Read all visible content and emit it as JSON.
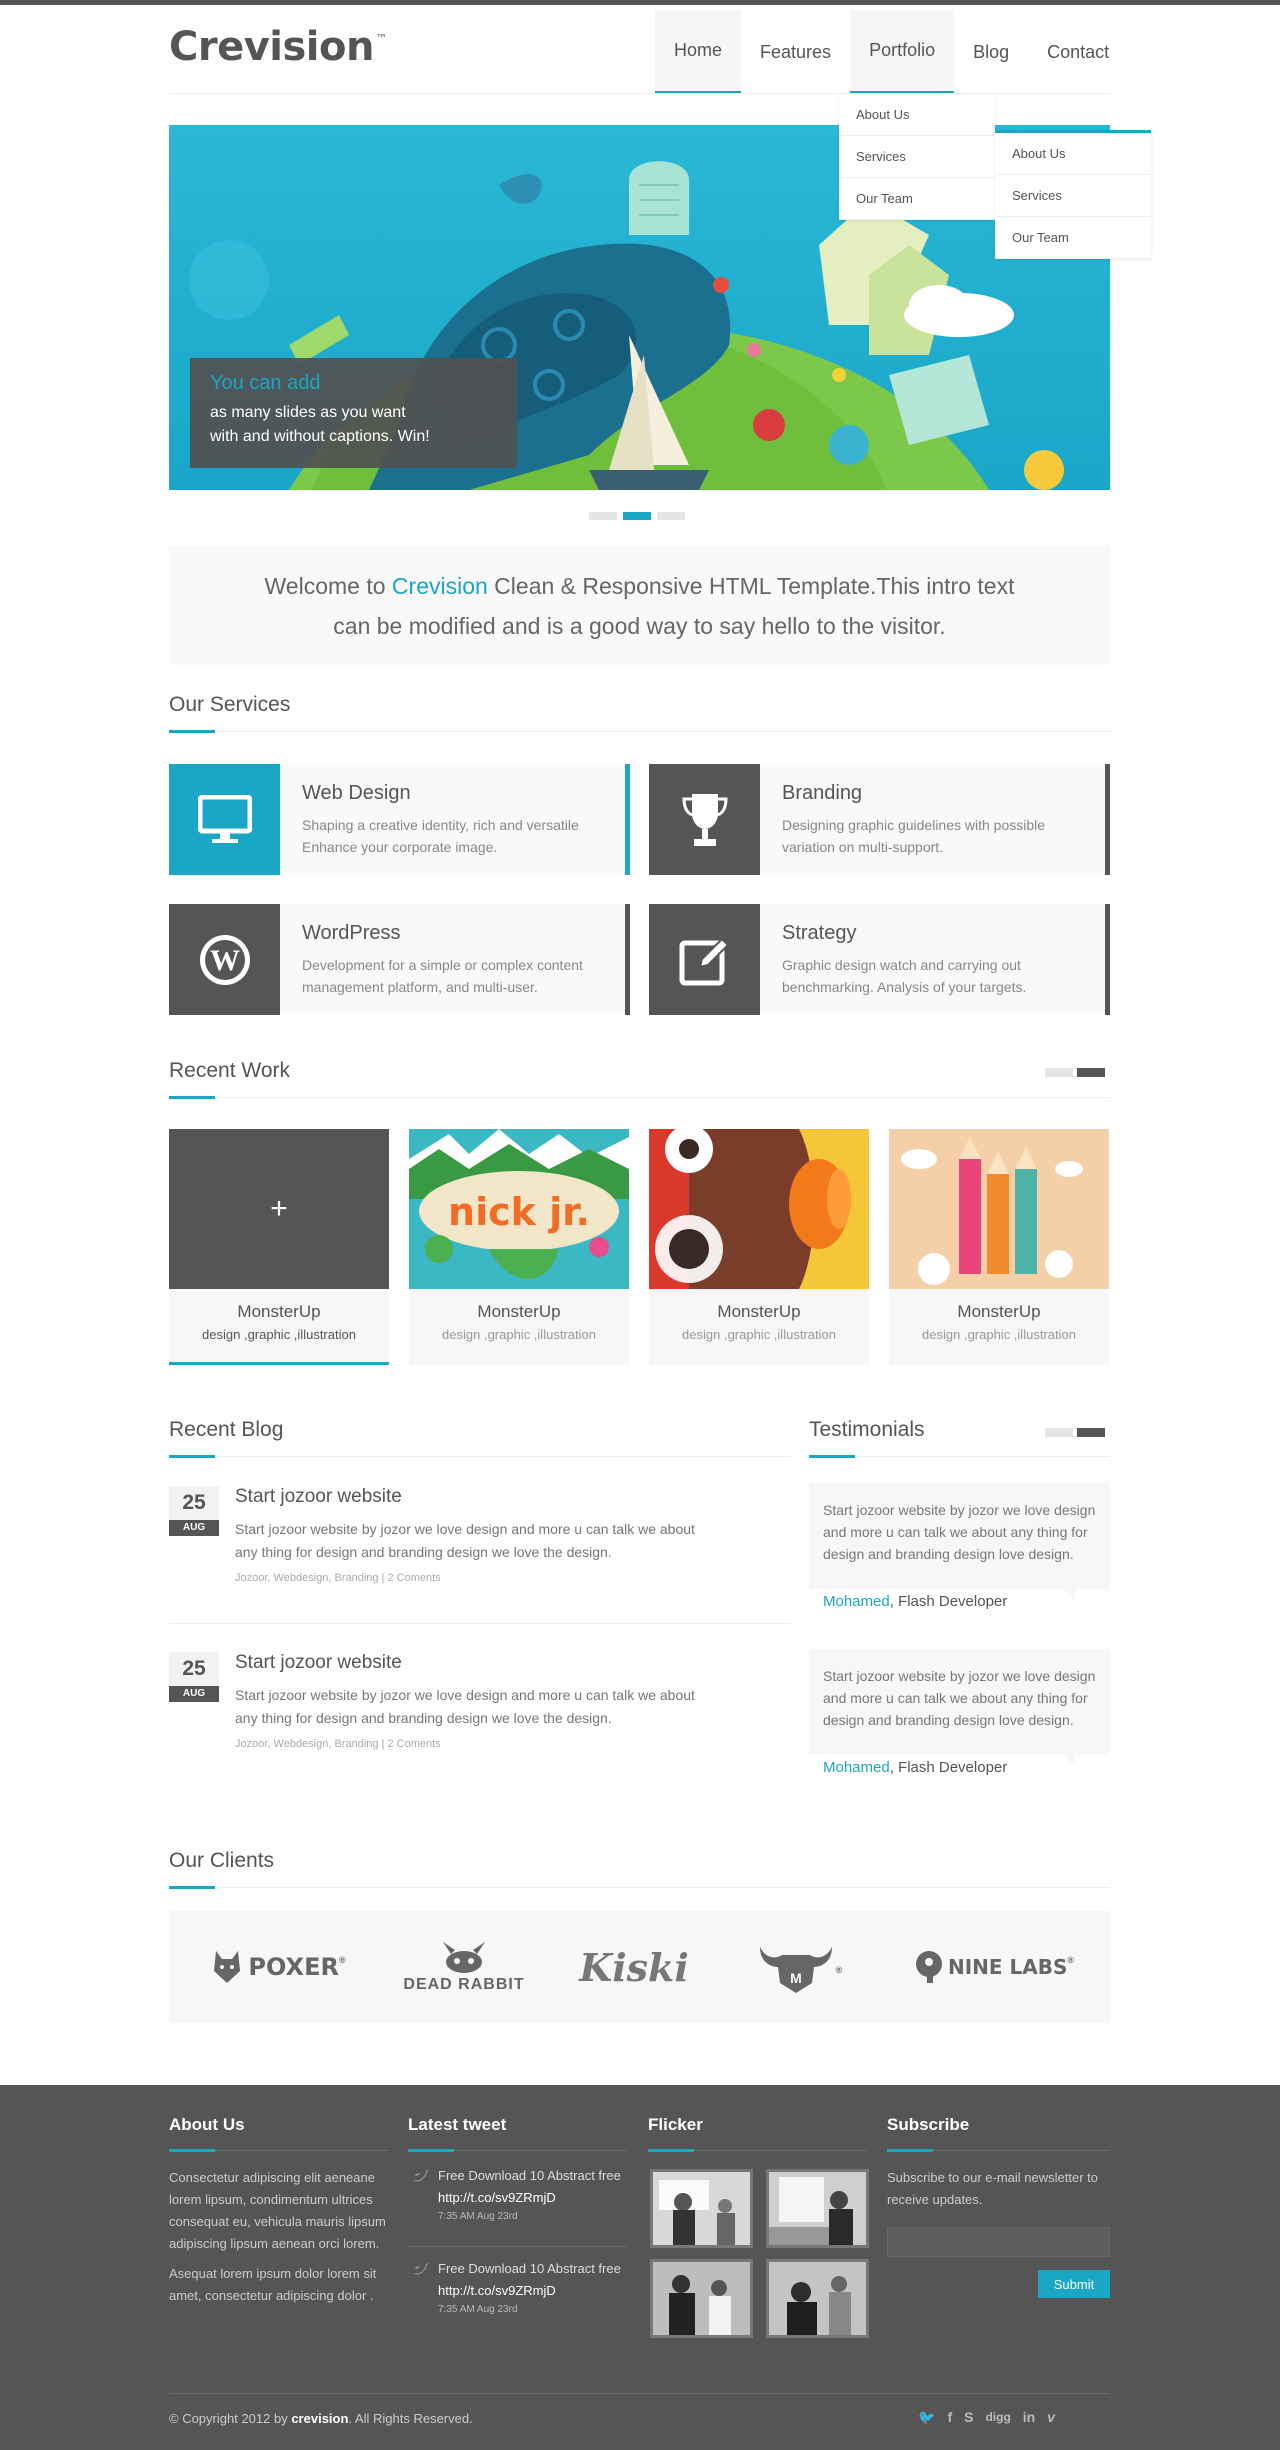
{
  "header": {
    "logo": "Crevision",
    "logo_tm": "™",
    "nav": [
      "Home",
      "Features",
      "Portfolio",
      "Blog",
      "Contact"
    ],
    "dropdown": [
      "About Us",
      "Services",
      "Our Team"
    ],
    "subdropdown": [
      "About Us",
      "Services",
      "Our Team"
    ]
  },
  "slider": {
    "caption_title": "You can add",
    "caption_line1": "as many slides as you want",
    "caption_line2": "with and without captions. Win!",
    "active_dot": 2,
    "dot_count": 3
  },
  "intro": {
    "pre": "Welcome to ",
    "brand": "Crevision",
    "post": " Clean & Responsive HTML Template.This intro text",
    "line2": "can be modified and is a good way to say hello to the visitor."
  },
  "services": {
    "title": "Our Services",
    "items": [
      {
        "title": "Web Design",
        "text": "Shaping a creative identity, rich and versatile Enhance your corporate image.",
        "icon": "monitor-icon",
        "color": "#1aa7c6"
      },
      {
        "title": "Branding",
        "text": "Designing graphic guidelines with possible variation on multi-support.",
        "icon": "trophy-icon",
        "color": "#555555"
      },
      {
        "title": "WordPress",
        "text": "Development for a simple or complex content management platform, and multi-user.",
        "icon": "wordpress-icon",
        "color": "#555555"
      },
      {
        "title": "Strategy",
        "text": "Graphic design watch and carrying out benchmarking. Analysis of your targets.",
        "icon": "edit-icon",
        "color": "#555555"
      }
    ]
  },
  "work": {
    "title": "Recent Work",
    "items": [
      {
        "title": "MonsterUp",
        "sub": "design ,graphic ,illustration",
        "thumb": "plus-icon"
      },
      {
        "title": "MonsterUp",
        "sub": "design ,graphic ,illustration",
        "thumb": "nick-jr-artwork"
      },
      {
        "title": "MonsterUp",
        "sub": "design ,graphic ,illustration",
        "thumb": "monster-artwork"
      },
      {
        "title": "MonsterUp",
        "sub": "design ,graphic ,illustration",
        "thumb": "pencils-artwork"
      }
    ],
    "plus": "+"
  },
  "blog": {
    "title": "Recent Blog",
    "posts": [
      {
        "day": "25",
        "month": "AUG",
        "title": "Start jozoor website",
        "text": "Start jozoor website by jozor we love design and more u can talk we about any thing for design and branding design we love the design.",
        "meta": "Jozoor, Webdesign, Branding | 2 Coments"
      },
      {
        "day": "25",
        "month": "AUG",
        "title": "Start jozoor website",
        "text": "Start jozoor website by jozor we love design and more u can talk we about any thing for design and branding design we love the design.",
        "meta": "Jozoor, Webdesign, Branding | 2 Coments"
      }
    ]
  },
  "testimonials": {
    "title": "Testimonials",
    "items": [
      {
        "text": "Start jozoor website by jozor we love design and more u can talk we about any thing for design and branding design love design.",
        "name": "Mohamed",
        "role": ", Flash Developer"
      },
      {
        "text": "Start jozoor website by jozor we love design and more u can talk we about any thing for design and branding design love design.",
        "name": "Mohamed",
        "role": ", Flash Developer"
      }
    ]
  },
  "clients": {
    "title": "Our Clients",
    "items": [
      "POXER",
      "DEAD RABBIT",
      "Kiski",
      "",
      "NINE LABS"
    ],
    "marks": [
      "®",
      "",
      "",
      "®",
      "®"
    ]
  },
  "footer": {
    "about_title": "About Us",
    "about_p1": "Consectetur adipiscing elit aeneane lorem lipsum, condimentum ultrices consequat eu, vehicula mauris lipsum adipiscing lipsum aenean orci lorem.",
    "about_p2": "Asequat lorem ipsum dolor lorem sit amet, consectetur adipiscing dolor .",
    "tweet_title": "Latest tweet",
    "tweets": [
      {
        "text": "Free Download 10 Abstract free",
        "link": "http://t.co/sv9ZRmjD",
        "time": "7:35 AM Aug 23rd"
      },
      {
        "text": "Free Download 10 Abstract free",
        "link": "http://t.co/sv9ZRmjD",
        "time": "7:35 AM Aug 23rd"
      }
    ],
    "flicker_title": "Flicker",
    "subscribe_title": "Subscribe",
    "subscribe_text": "Subscribe to our e-mail newsletter to receive updates.",
    "submit": "Submit",
    "copyright_pre": "© Copyright 2012 by ",
    "copyright_brand": "crevision",
    "copyright_post": ". All Rights Reserved.",
    "social": [
      "twitter-icon",
      "facebook-icon",
      "skype-icon",
      "digg-icon",
      "linkedin-icon",
      "vimeo-icon"
    ],
    "social_labels": [
      "🐦",
      "f",
      "S",
      "digg",
      "in",
      "v"
    ]
  }
}
